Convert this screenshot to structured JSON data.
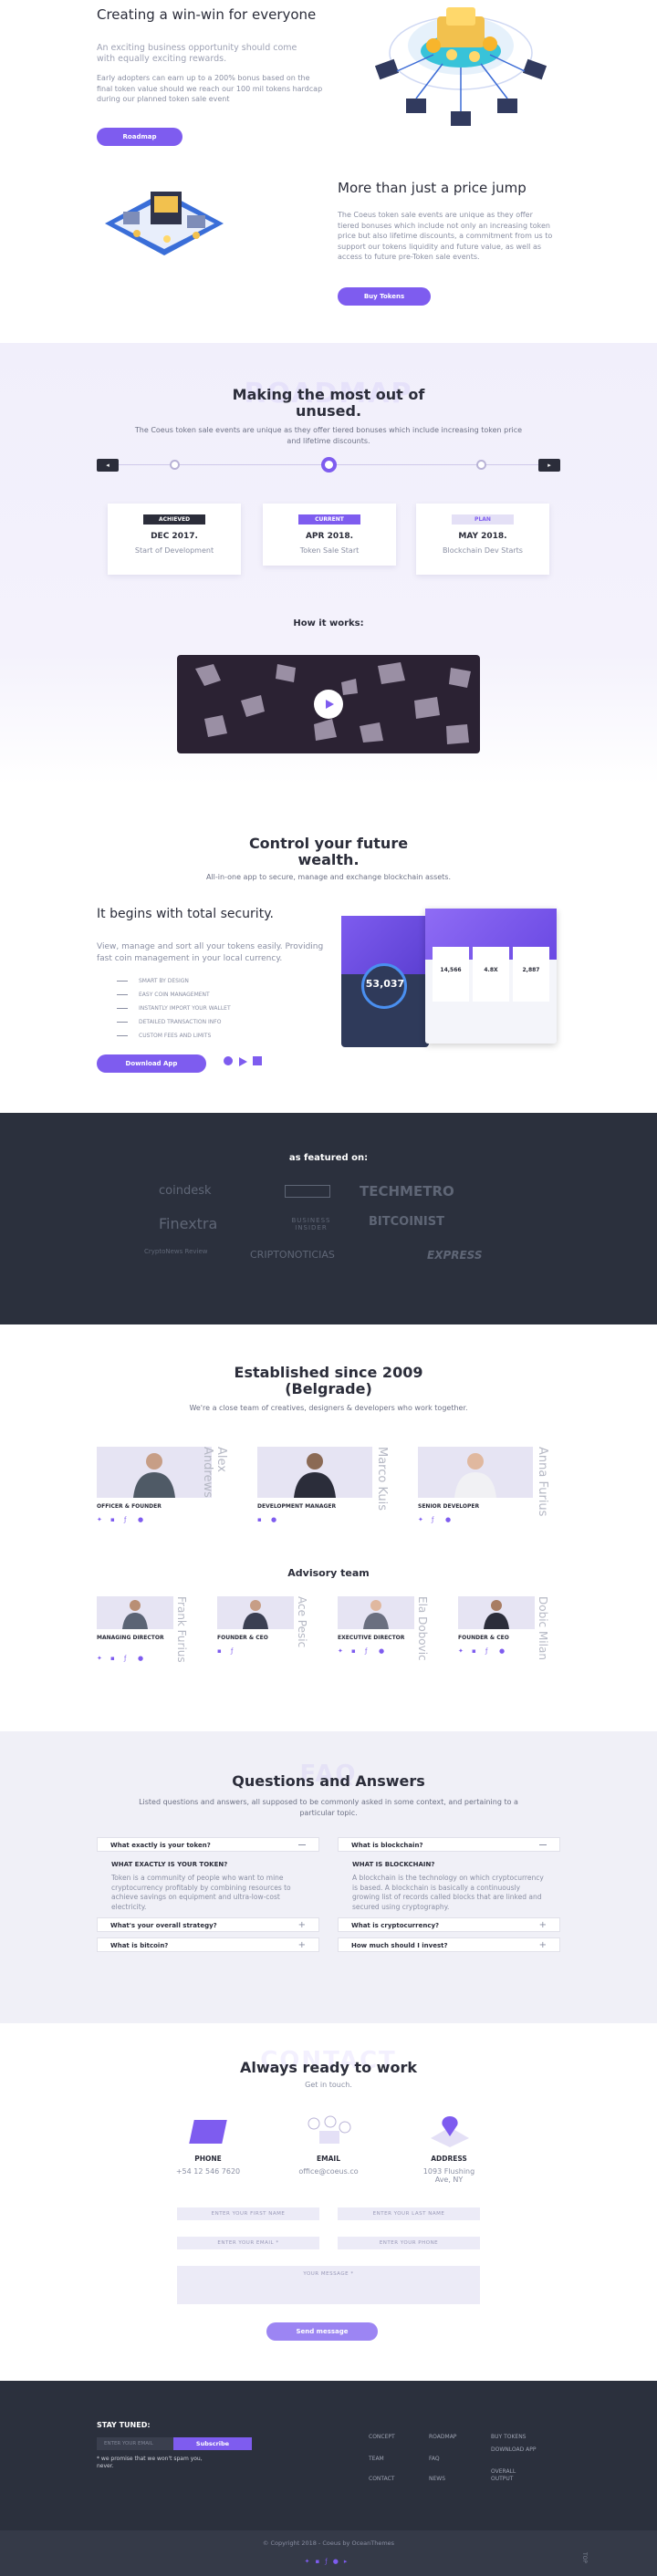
{
  "intro1": {
    "title": "Creating a win-win for everyone",
    "subtitle": "An exciting business opportunity should come with equally exciting rewards.",
    "text": "Early adopters can earn up to a 200% bonus based on the final token value should we reach our 100 mil tokens hardcap during our planned token sale event",
    "button": "Roadmap"
  },
  "intro2": {
    "title": "More than just a price jump",
    "text": "The Coeus token sale events are unique as they offer tiered bonuses which include not only an increasing token price but also lifetime discounts, a commitment from us to support our tokens liquidity and future value, as well as access to future pre-Token sale events.",
    "button": "Buy Tokens"
  },
  "roadmap": {
    "ghost": "ROADMAP",
    "title": "Making the most out of unused.",
    "text": "The Coeus token sale events are unique as they offer tiered bonuses which include increasing token price and lifetime discounts.",
    "cards": [
      {
        "badge": "ACHIEVED",
        "date": "DEC 2017.",
        "desc": "Start of Development"
      },
      {
        "badge": "CURRENT",
        "date": "APR 2018.",
        "desc": "Token Sale Start"
      },
      {
        "badge": "PLAN",
        "date": "MAY 2018.",
        "desc": "Blockchain Dev Starts"
      }
    ],
    "how": "How it works:"
  },
  "wallet": {
    "title": "Control your future wealth.",
    "text": "All-in-one app to secure, manage and exchange blockchain assets.",
    "subtitle": "It begins with total security.",
    "desc": "View, manage and sort all your tokens easily. Providing fast coin management in your local currency.",
    "features": [
      "SMART BY DESIGN",
      "EASY COIN MANAGEMENT",
      "INSTANTLY IMPORT YOUR WALLET",
      "DETAILED TRANSACTION INFO",
      "CUSTOM FEES AND LIMITS"
    ],
    "button": "Download App",
    "phone1": {
      "value": "53,037"
    },
    "phone2": {
      "v1": "14,566",
      "v2": "4.8X",
      "v3": "2,887"
    }
  },
  "featured": {
    "title": "as featured on:",
    "logos": [
      "coindesk",
      "TECHMETRO",
      "Finextra",
      "BUSINESS INSIDER",
      "BITCOINIST",
      "CryptoNews Review",
      "CRIPTONOTICIAS",
      "EXPRESS"
    ]
  },
  "team": {
    "title": "Established since 2009 (Belgrade)",
    "text": "We're a close team of creatives, designers & developers who work together.",
    "members": [
      {
        "name": "Alex Andrews",
        "role": "OFFICER & FOUNDER"
      },
      {
        "name": "Marco Kuis",
        "role": "DEVELOPMENT MANAGER"
      },
      {
        "name": "Anna Furius",
        "role": "SENIOR DEVELOPER"
      }
    ],
    "advisory": "Advisory team",
    "advisors": [
      {
        "name": "Frank Furius",
        "role": "MANAGING DIRECTOR"
      },
      {
        "name": "Ace Pesic",
        "role": "FOUNDER & CEO"
      },
      {
        "name": "Ela Dobovic",
        "role": "EXECUTIVE DIRECTOR"
      },
      {
        "name": "Dobic Milan",
        "role": "FOUNDER & CEO"
      }
    ]
  },
  "faq": {
    "ghost": "FAQ",
    "title": "Questions and Answers",
    "text": "Listed questions and answers, all supposed to be commonly asked in some context, and pertaining to a particular topic.",
    "left": [
      {
        "q": "What exactly is your token?",
        "open": true,
        "h": "WHAT EXACTLY IS YOUR TOKEN?",
        "a": "Token is a community of people who want to mine cryptocurrency profitably by combining resources to achieve savings on equipment and ultra-low-cost electricity."
      },
      {
        "q": "What's your overall strategy?"
      },
      {
        "q": "What is bitcoin?"
      }
    ],
    "right": [
      {
        "q": "What is blockchain?",
        "open": true,
        "h": "WHAT IS BLOCKCHAIN?",
        "a": "A blockchain is the technology on which cryptocurrency is based. A blockchain is basically a continuously growing list of records called blocks that are linked and secured using cryptography."
      },
      {
        "q": "What is cryptocurrency?"
      },
      {
        "q": "How much should I invest?"
      }
    ]
  },
  "contact": {
    "ghost": "CONTACT",
    "title": "Always ready to work",
    "sub": "Get in touch.",
    "cols": [
      {
        "label": "PHONE",
        "value": "+54 12 546 7620"
      },
      {
        "label": "EMAIL",
        "value": "office@coeus.co"
      },
      {
        "label": "ADDRESS",
        "value": "1093 Flushing Ave, NY"
      }
    ],
    "first": "ENTER YOUR FIRST NAME",
    "last": "ENTER YOUR LAST NAME",
    "email": "ENTER YOUR EMAIL *",
    "phone": "ENTER YOUR PHONE",
    "message": "YOUR MESSAGE *",
    "send": "Send message"
  },
  "footer": {
    "stay": "STAY TUNED:",
    "input": "ENTER YOUR EMAIL",
    "subscribe": "Subscribe",
    "note": "* we promise that we won't spam you, never.",
    "links": [
      "CONCEPT",
      "ROADMAP",
      "BUY TOKENS",
      "TEAM",
      "FAQ",
      "DOWNLOAD APP",
      "CONTACT",
      "NEWS",
      "OVERALL OUTPUT"
    ],
    "copyright": "© Copyright 2018 - Coeus by OceanThemes",
    "top": "TOP"
  }
}
